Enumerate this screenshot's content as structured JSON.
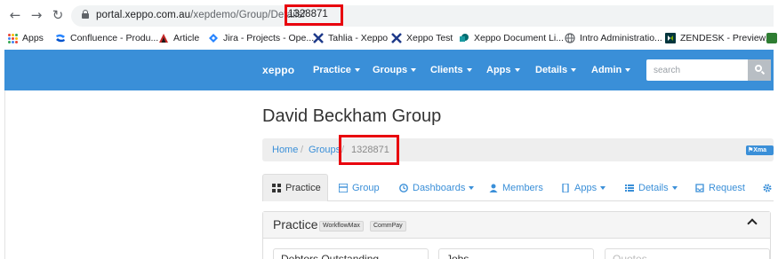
{
  "browser": {
    "url_host": "portal.xeppo.com.au",
    "url_path": "/xepdemo/Group/Details/",
    "url_id": "1328871",
    "bookmarks": [
      {
        "label": "Apps",
        "icon": "apps-grid-icon"
      },
      {
        "label": "Confluence - Produ...",
        "icon": "confluence-icon"
      },
      {
        "label": "Article",
        "icon": "article-icon"
      },
      {
        "label": "Jira - Projects - Ope...",
        "icon": "jira-icon"
      },
      {
        "label": "Tahlia - Xeppo",
        "icon": "xeppo-icon"
      },
      {
        "label": "Xeppo Test",
        "icon": "xeppo-icon"
      },
      {
        "label": "Xeppo Document Li...",
        "icon": "sharepoint-icon"
      },
      {
        "label": "Intro Administratio...",
        "icon": "globe-icon"
      },
      {
        "label": "ZENDESK - Preview...",
        "icon": "zendesk-icon"
      }
    ]
  },
  "navbar": {
    "brand": "xeppo",
    "items": [
      "Practice",
      "Groups",
      "Clients",
      "Apps",
      "Details",
      "Admin"
    ],
    "search_placeholder": "search"
  },
  "page": {
    "title": "David Beckham Group",
    "breadcrumb": [
      "Home",
      "Groups",
      "1328871"
    ],
    "tag": "Xma"
  },
  "tabs": [
    {
      "label": "Practice",
      "icon": "grid-icon",
      "dropdown": false,
      "active": true
    },
    {
      "label": "Group",
      "icon": "group-icon",
      "dropdown": false,
      "active": false
    },
    {
      "label": "Dashboards",
      "icon": "clock-icon",
      "dropdown": true,
      "active": false
    },
    {
      "label": "Members",
      "icon": "user-icon",
      "dropdown": false,
      "active": false
    },
    {
      "label": "Apps",
      "icon": "mobile-icon",
      "dropdown": true,
      "active": false
    },
    {
      "label": "Details",
      "icon": "list-icon",
      "dropdown": true,
      "active": false
    },
    {
      "label": "Request",
      "icon": "inbox-icon",
      "dropdown": false,
      "active": false
    }
  ],
  "panel": {
    "title": "Practice",
    "badges": [
      "WorkflowMax",
      "CommPay"
    ],
    "cards": [
      "Debtors Outstanding",
      "Jobs",
      "Quotes"
    ]
  },
  "colors": {
    "navbar": "#3a8fd8",
    "highlight": "#e8000d",
    "link": "#3a8fd8"
  }
}
